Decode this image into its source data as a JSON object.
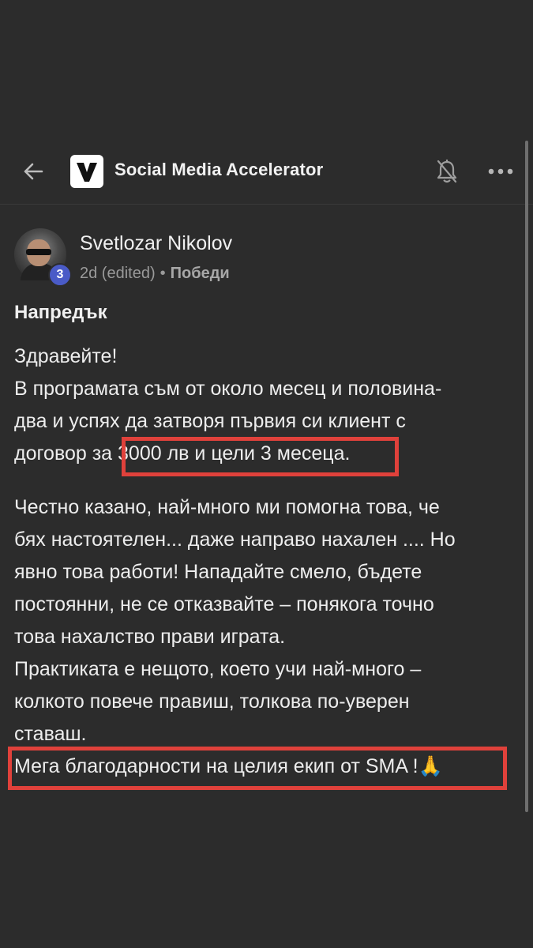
{
  "header": {
    "group_title": "Social Media Accelerator",
    "back_icon": "arrow-left-icon",
    "logo_icon": "sma-logo-icon",
    "notification_icon": "bell-off-icon",
    "more_icon": "more-horizontal-icon"
  },
  "post": {
    "author": "Svetlozar Nikolov",
    "level": "3",
    "time": "2d (edited)",
    "separator": "•",
    "category": "Победи",
    "title": "Напредък",
    "paragraph1": [
      "Здравейте!",
      "В програмата съм от около месец и половина-",
      "два и успях да затворя първия си клиент с"
    ],
    "line4_prefix": "договор за ",
    "line4_highlight": "3000 лв и цели 3 месеца.",
    "paragraph2": [
      "Честно казано, най-много ми помогна това, че",
      "бях настоятелен... даже направо нахален .... Но",
      "явно това работи! Нападайте смело, бъдете",
      "постоянни, не се отказвайте – понякога точно",
      "това нахалство прави играта.",
      "Практиката е нещото, което учи най-много –",
      "колкото повече правиш, толкова по-уверен",
      "ставаш."
    ],
    "last_line": "Мега благодарности на целия екип от SMA !🙏"
  },
  "colors": {
    "background": "#2c2c2c",
    "highlight_border": "#e0413b",
    "level_badge": "#4a5bc7"
  }
}
